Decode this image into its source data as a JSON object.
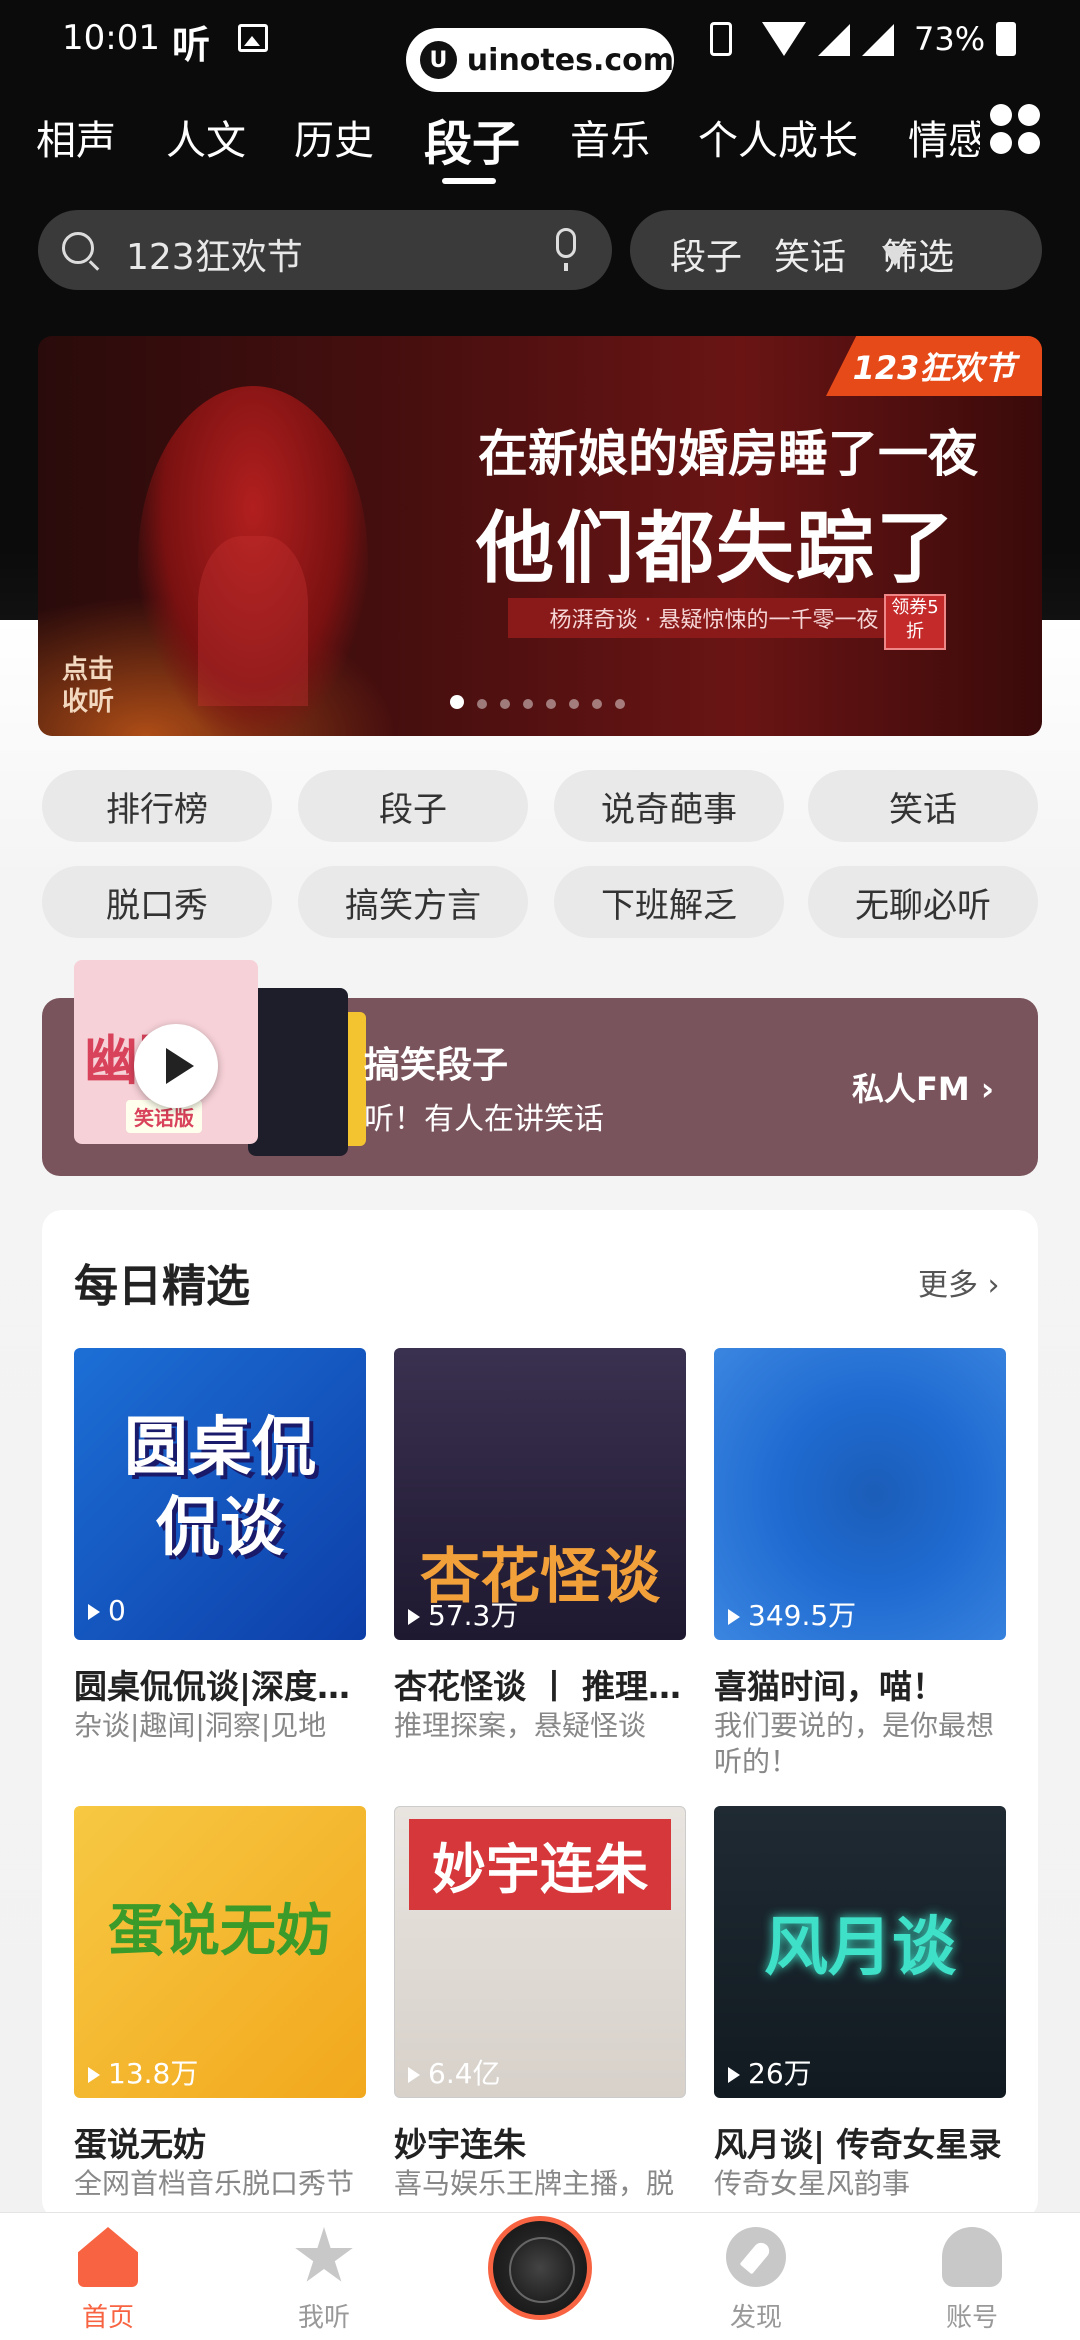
{
  "status_bar": {
    "time": "10:01",
    "hear_icon": "听",
    "watermark": "uinotes.com",
    "battery": "73%"
  },
  "tabs": [
    "相声",
    "人文",
    "历史",
    "段子",
    "音乐",
    "个人成长",
    "情感"
  ],
  "active_tab": "段子",
  "search": {
    "placeholder": "123狂欢节",
    "chip_1": "段子",
    "chip_2": "笑话",
    "filter_label": "筛选"
  },
  "banner": {
    "badge": "123狂欢节",
    "line_1": "在新娘的婚房睡了一夜",
    "line_2": "他们都失踪了",
    "subtitle": "杨湃奇谈 · 悬疑惊悚的一千零一夜",
    "coupon": "领券5折",
    "click_hint_1": "点击",
    "click_hint_2": "收听"
  },
  "tags": [
    "排行榜",
    "段子",
    "说奇葩事",
    "笑话",
    "脱口秀",
    "搞笑方言",
    "下班解乏",
    "无聊必听"
  ],
  "fm": {
    "title": "搞笑段子",
    "subtitle": "听！有人在讲笑话",
    "link": "私人FM",
    "cover_text": "幽默",
    "cover_tag": "笑话版"
  },
  "daily": {
    "title": "每日精选",
    "more": "更多",
    "items": [
      {
        "art": "圆桌侃侃谈",
        "count": "0",
        "name": "圆桌侃侃谈|深度…",
        "desc": "杂谈|趣闻|洞察|见地"
      },
      {
        "art": "杏花怪谈",
        "count": "57.3万",
        "name": "杏花怪谈 丨 推理…",
        "desc": "推理探案，悬疑怪谈"
      },
      {
        "art": "",
        "count": "349.5万",
        "name": "喜猫时间，喵！",
        "desc": "我们要说的，是你最想听的！"
      },
      {
        "art": "蛋说无妨",
        "count": "13.8万",
        "name": "蛋说无妨",
        "desc": "全网首档音乐脱口秀节"
      },
      {
        "art": "妙宇连朱",
        "count": "6.4亿",
        "name": "妙宇连朱",
        "desc": "喜马娱乐王牌主播，脱"
      },
      {
        "art": "风月谈",
        "count": "26万",
        "name": "风月谈| 传奇女星录",
        "desc": "传奇女星风韵事"
      }
    ]
  },
  "bottom_nav": {
    "home": "首页",
    "listen": "我听",
    "discover": "发现",
    "account": "账号"
  },
  "colors": {
    "accent": "#f86442",
    "fm_card": "#7a545c",
    "banner_badge": "#e64a19"
  },
  "icons": [
    "search-icon",
    "mic-icon",
    "filter-icon",
    "grid-icon",
    "play-icon",
    "chevron-right-icon",
    "home-icon",
    "star-icon",
    "compass-icon",
    "account-icon"
  ]
}
